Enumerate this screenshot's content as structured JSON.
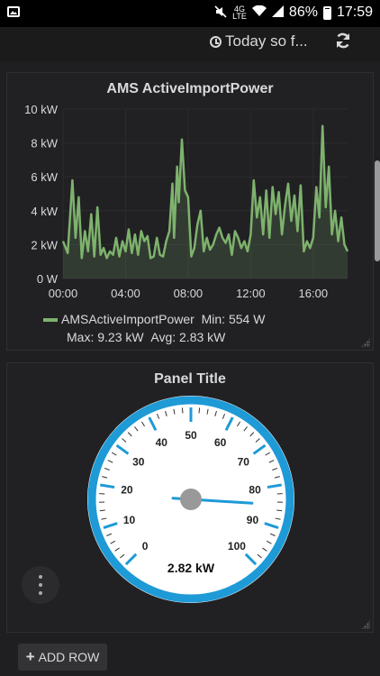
{
  "status_bar": {
    "network": "4G",
    "network_sub": "LTE",
    "battery": "86%",
    "time": "17:59"
  },
  "toolbar": {
    "time_range": "Today so f...",
    "icons": {
      "clock": "clock-icon",
      "refresh": "refresh-icon"
    }
  },
  "panel1": {
    "title": "AMS ActiveImportPower",
    "legend": {
      "series": "AMSActiveImportPower",
      "min": "Min: 554 W",
      "max": "Max: 9.23 kW",
      "avg": "Avg: 2.83 kW"
    }
  },
  "chart_data": {
    "type": "area",
    "title": "AMS ActiveImportPower",
    "xlabel": "",
    "ylabel": "",
    "x_ticks": [
      "00:00",
      "04:00",
      "08:00",
      "12:00",
      "16:00"
    ],
    "y_ticks": [
      "0 W",
      "2 kW",
      "4 kW",
      "6 kW",
      "8 kW",
      "10 kW"
    ],
    "ylim": [
      0,
      10
    ],
    "xlim": [
      0,
      18.2
    ],
    "color": "#7eb26d",
    "series": [
      {
        "name": "AMSActiveImportPower",
        "x": [
          0,
          0.3,
          0.6,
          0.8,
          1.0,
          1.2,
          1.4,
          1.6,
          1.8,
          2.0,
          2.2,
          2.4,
          2.6,
          2.8,
          3.0,
          3.2,
          3.4,
          3.6,
          3.8,
          4.0,
          4.2,
          4.4,
          4.6,
          4.8,
          5.0,
          5.2,
          5.4,
          5.6,
          5.8,
          6.0,
          6.2,
          6.4,
          6.6,
          6.8,
          7.0,
          7.1,
          7.3,
          7.4,
          7.6,
          7.8,
          8.0,
          8.2,
          8.4,
          8.6,
          8.8,
          9.0,
          9.2,
          9.4,
          9.6,
          9.8,
          10.0,
          10.2,
          10.4,
          10.6,
          10.8,
          11.0,
          11.2,
          11.4,
          11.6,
          11.8,
          12.0,
          12.2,
          12.4,
          12.6,
          12.8,
          13.0,
          13.2,
          13.4,
          13.6,
          13.8,
          14.0,
          14.2,
          14.4,
          14.6,
          14.8,
          15.0,
          15.2,
          15.4,
          15.6,
          15.8,
          16.0,
          16.2,
          16.4,
          16.6,
          16.8,
          17.0,
          17.2,
          17.4,
          17.6,
          17.8,
          18.0,
          18.2
        ],
        "values": [
          2.2,
          1.5,
          5.8,
          2.4,
          4.8,
          1.2,
          2.8,
          1.6,
          3.8,
          1.3,
          4.2,
          1.4,
          1.8,
          1.2,
          1.6,
          1.4,
          2.4,
          1.3,
          2.2,
          1.6,
          2.9,
          1.5,
          2.6,
          1.4,
          2.8,
          2.2,
          2.5,
          1.2,
          1.3,
          2.4,
          1.4,
          1.3,
          2.2,
          2.8,
          5.6,
          2.4,
          6.6,
          4.5,
          8.2,
          5.2,
          4.8,
          1.3,
          1.8,
          3.2,
          4.0,
          1.6,
          2.4,
          1.7,
          2.0,
          2.6,
          3.0,
          2.4,
          2.1,
          2.6,
          1.4,
          2.8,
          2.4,
          1.8,
          2.2,
          1.6,
          2.6,
          5.8,
          3.6,
          4.8,
          2.6,
          5.2,
          2.4,
          5.4,
          3.8,
          5.1,
          2.6,
          4.3,
          5.6,
          3.4,
          4.9,
          2.8,
          5.5,
          1.6,
          2.2,
          1.8,
          2.4,
          5.4,
          3.6,
          9.0,
          4.2,
          6.6,
          2.6,
          4.0,
          2.2,
          3.6,
          2.0,
          1.6
        ]
      }
    ],
    "min": 0.554,
    "max": 9.23,
    "avg": 2.83
  },
  "panel2": {
    "title": "Panel Title",
    "gauge": {
      "value_text": "2.82 kW",
      "pointer_value": 18,
      "labels": [
        "0",
        "10",
        "20",
        "30",
        "40",
        "50",
        "60",
        "70",
        "80",
        "90",
        "100"
      ],
      "ring_color": "#1e9ad6"
    }
  },
  "add_row": {
    "label": "ADD ROW"
  }
}
